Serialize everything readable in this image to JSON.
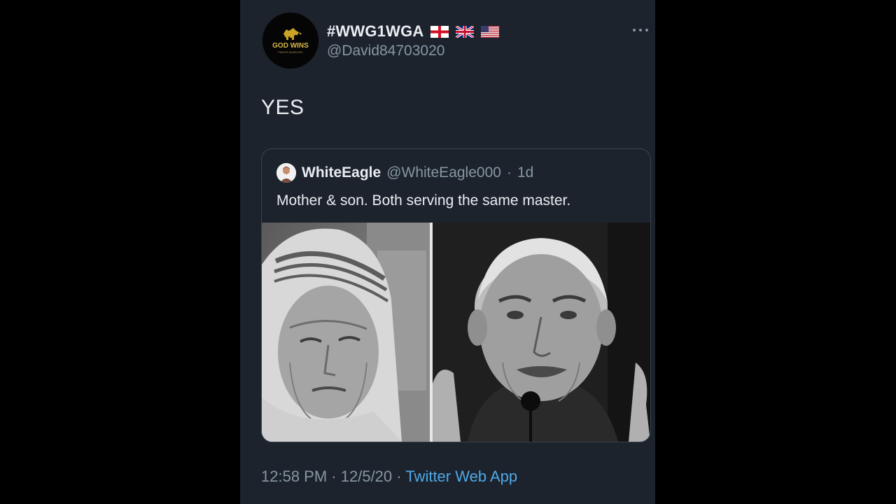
{
  "author": {
    "display_name": "#WWG1WGA",
    "handle": "@David84703020",
    "avatar_lettering": "GOD WINS",
    "avatar_sublettering": "PRAYER WARRIORS",
    "flags": [
      "england-flag-icon",
      "uk-flag-icon",
      "us-flag-icon"
    ]
  },
  "tweet": {
    "text": "YES"
  },
  "quoted_tweet": {
    "display_name": "WhiteEagle",
    "handle": "@WhiteEagle000",
    "separator": "·",
    "age": "1d",
    "text": "Mother & son. Both serving the same master.",
    "media": [
      "photo-left",
      "photo-right"
    ]
  },
  "footer": {
    "time": "12:58 PM",
    "separator": "·",
    "date": "12/5/20",
    "source": "Twitter Web App"
  },
  "icons": {
    "more": "more-options-icon"
  },
  "colors": {
    "background": "#000000",
    "card": "#1c232c",
    "primary_text": "#e9eef2",
    "secondary_text": "#8796a4",
    "link": "#4ea8e8",
    "border": "#38444d"
  }
}
